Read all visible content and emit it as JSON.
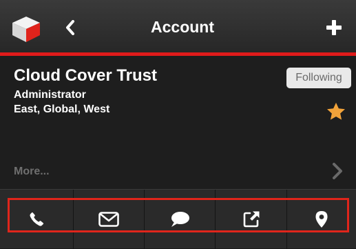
{
  "nav": {
    "title": "Account",
    "logo_icon": "cube-logo-icon",
    "back_icon": "chevron-left-icon",
    "add_icon": "plus-icon",
    "accent_color": "#e01b1b"
  },
  "account": {
    "name": "Cloud Cover Trust",
    "role": "Administrator",
    "regions": "East, Global, West",
    "follow_label": "Following",
    "favorite_icon": "star-icon",
    "favorite_color": "#f2a33a",
    "more_label": "More...",
    "more_icon": "chevron-right-icon"
  },
  "actions": [
    {
      "icon": "phone-icon",
      "name": "call-button"
    },
    {
      "icon": "mail-icon",
      "name": "email-button"
    },
    {
      "icon": "chat-bubble-icon",
      "name": "message-button"
    },
    {
      "icon": "external-link-icon",
      "name": "open-external-button"
    },
    {
      "icon": "map-pin-icon",
      "name": "location-button"
    }
  ]
}
